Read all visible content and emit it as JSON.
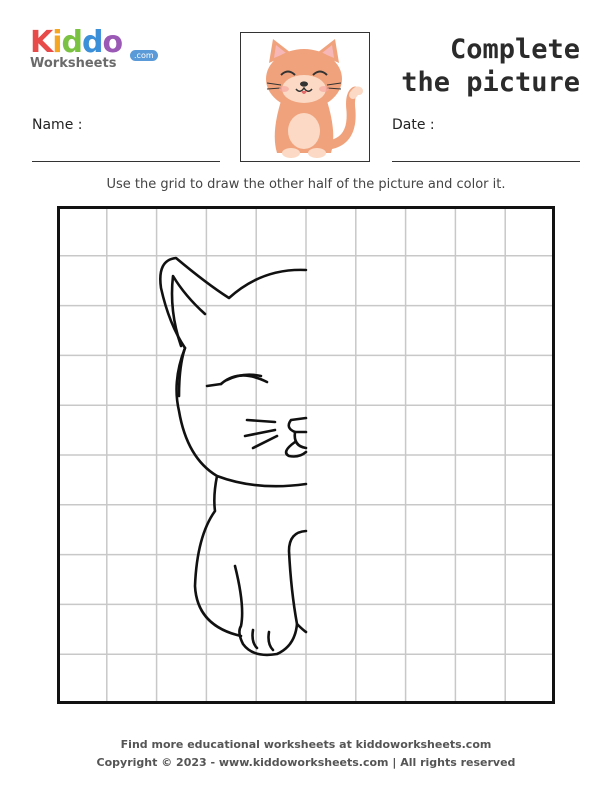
{
  "brand": {
    "letters": [
      {
        "ch": "K",
        "color": "#e84a4a"
      },
      {
        "ch": "i",
        "color": "#f5a623"
      },
      {
        "ch": "d",
        "color": "#7cc242"
      },
      {
        "ch": "d",
        "color": "#3b8fd9"
      },
      {
        "ch": "o",
        "color": "#9b59b6"
      }
    ],
    "subtitle": "Worksheets",
    "domain_badge": ".com"
  },
  "title": {
    "line1": "Complete",
    "line2": "the picture"
  },
  "fields": {
    "name_label": "Name :",
    "date_label": "Date :"
  },
  "instruction": "Use the grid to draw the other half of the picture and color it.",
  "grid": {
    "columns": 10,
    "rows": 10,
    "line_color": "#c8c8c8",
    "border_color": "#111111"
  },
  "footer": {
    "line1": "Find more educational worksheets at kiddoworksheets.com",
    "line2": "Copyright © 2023 - www.kiddoworksheets.com  |  All rights reserved"
  },
  "colors": {
    "cat_body": "#f0a27c",
    "cat_light": "#fbd9c4",
    "outline": "#111111"
  }
}
